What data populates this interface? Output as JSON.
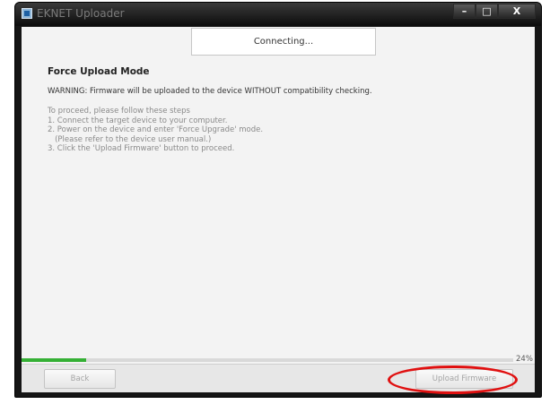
{
  "window": {
    "title": "EKNET Uploader",
    "controls": {
      "minimize": "–",
      "maximize": "□",
      "close": "X"
    }
  },
  "status": {
    "text": "Connecting..."
  },
  "content": {
    "heading": "Force Upload Mode",
    "warning": "WARNING: Firmware will be uploaded to the device WITHOUT compatibility checking.",
    "steps": [
      "To proceed, please follow these steps",
      "1. Connect the target device to your computer.",
      "2. Power on the device and enter 'Force Upgrade' mode.",
      "   (Please refer to the device user manual.)",
      "3. Click the 'Upload Firmware' button to proceed."
    ]
  },
  "progress": {
    "percent_label": "24%",
    "value": 0.24,
    "color": "#35b035"
  },
  "buttons": {
    "back": "Back",
    "upload": "Upload Firmware"
  },
  "annotation": {
    "color": "#e01010"
  }
}
